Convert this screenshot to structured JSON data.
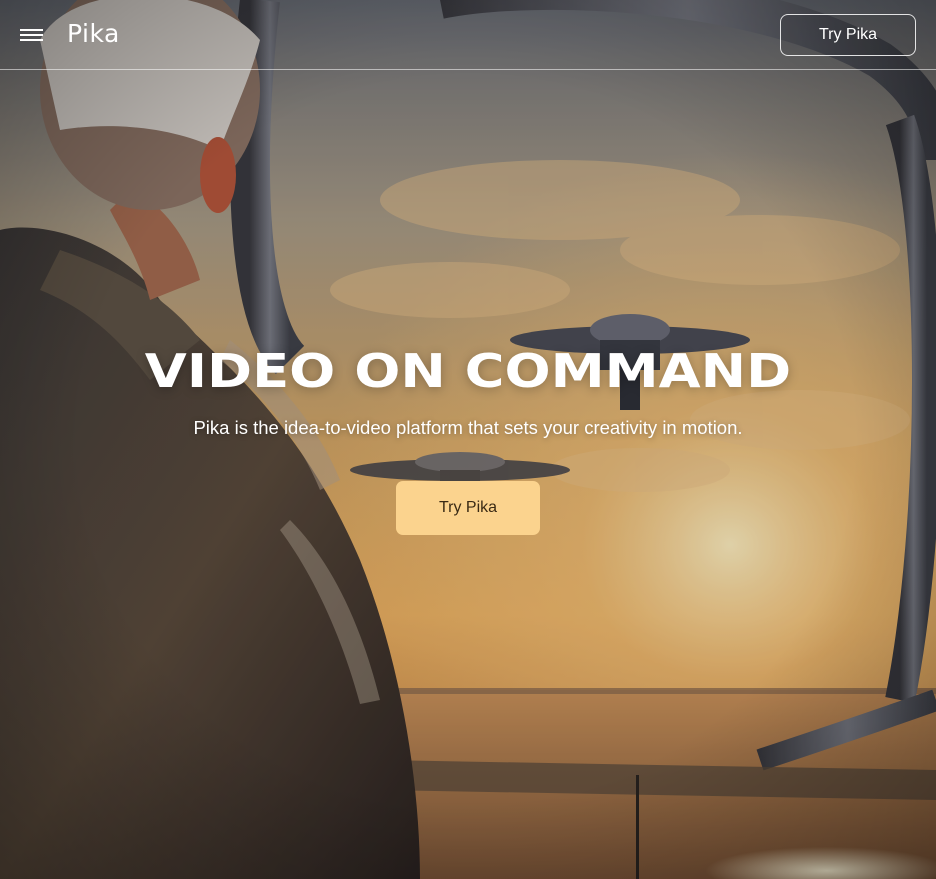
{
  "header": {
    "menu_icon": "hamburger-menu-icon",
    "logo_text": "Pika",
    "cta_label": "Try Pika"
  },
  "hero": {
    "title": "VIDEO ON COMMAND",
    "subtitle": "Pika is the idea-to-video platform that sets your creativity in motion.",
    "cta_label": "Try Pika"
  },
  "colors": {
    "cta_fill": "#fbd38e",
    "text": "#ffffff"
  }
}
